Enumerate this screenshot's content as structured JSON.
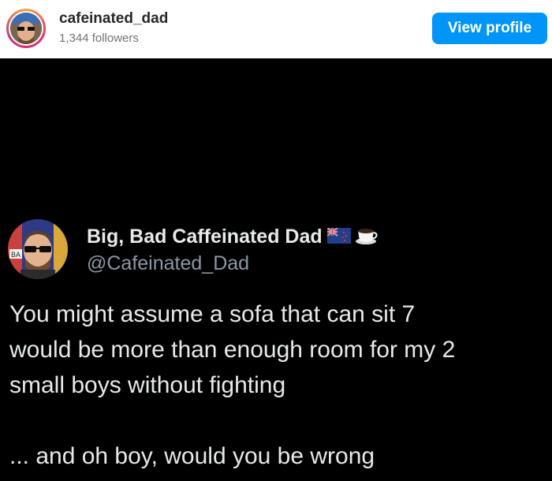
{
  "embed_header": {
    "username": "cafeinated_dad",
    "followers": "1,344 followers",
    "view_profile_label": "View profile",
    "button_color": "#0095f6"
  },
  "tweet": {
    "display_name": "Big, Bad Caffeinated Dad",
    "name_emojis": [
      "nz-flag-icon",
      "coffee-cup-icon"
    ],
    "handle": "@Cafeinated_Dad",
    "text_line1": "You might assume a sofa that can sit 7",
    "text_line2": "would be more than enough room for my 2",
    "text_line3": "small boys without fighting",
    "text_line4": "... and oh boy, would you be wrong",
    "background": "#000000"
  }
}
